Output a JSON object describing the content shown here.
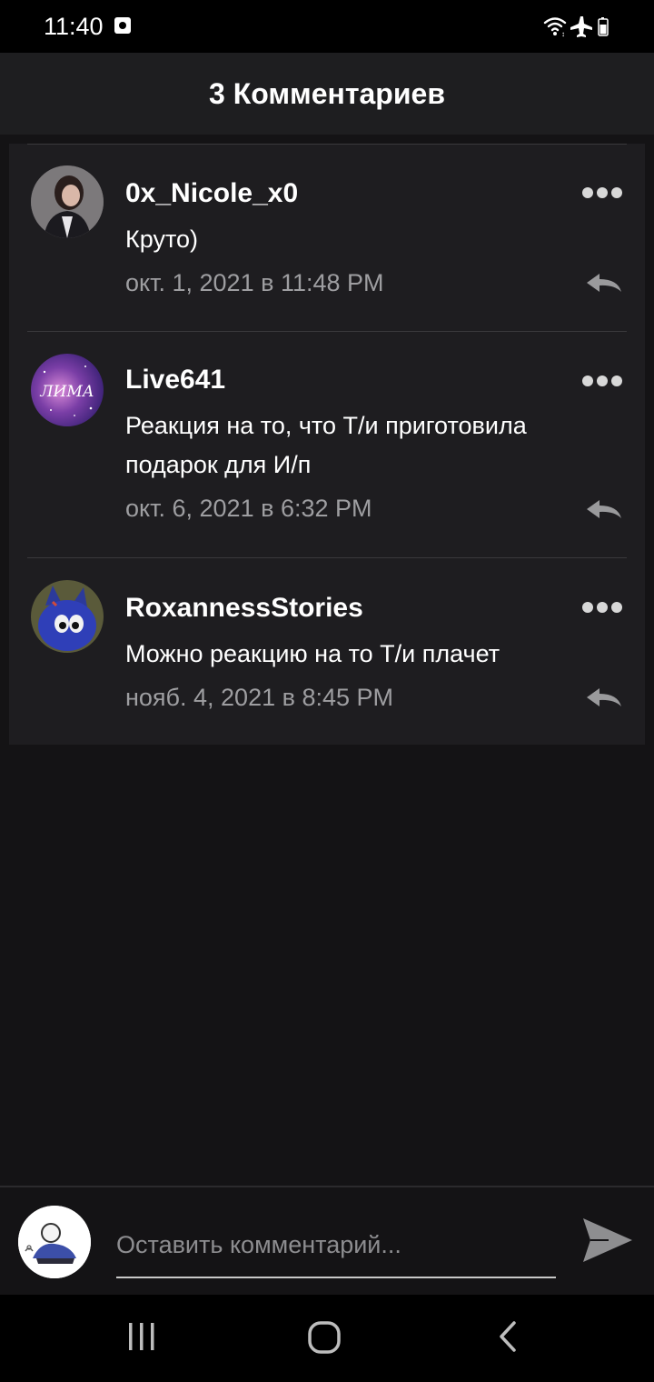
{
  "status_bar": {
    "time": "11:40",
    "icons": [
      "notification-icon",
      "wifi-icon",
      "airplane-icon",
      "battery-icon"
    ]
  },
  "header": {
    "title": "3 Комментариев"
  },
  "comments": [
    {
      "username": "0x_Nicole_x0",
      "text": "Круто)",
      "date": "окт. 1, 2021 в 11:48 PM",
      "avatar": "photo"
    },
    {
      "username": "Live641",
      "text": "Реакция на то, что Т/и приготовила подарок для И/п",
      "date": "окт. 6, 2021 в 6:32 PM",
      "avatar": "galaxy",
      "avatar_text": "ЛИМА"
    },
    {
      "username": "RoxannessStories",
      "text": "Можно реакцию на то Т/и плачет",
      "date": "нояб. 4, 2021 в 8:45 PM",
      "avatar": "cartoon"
    }
  ],
  "compose": {
    "placeholder": "Оставить комментарий..."
  },
  "colors": {
    "background": "#141315",
    "card": "#1e1d20",
    "header": "#1e1e20",
    "meta_text": "#9e9ea1",
    "icon_gray": "#9a9a9c"
  }
}
